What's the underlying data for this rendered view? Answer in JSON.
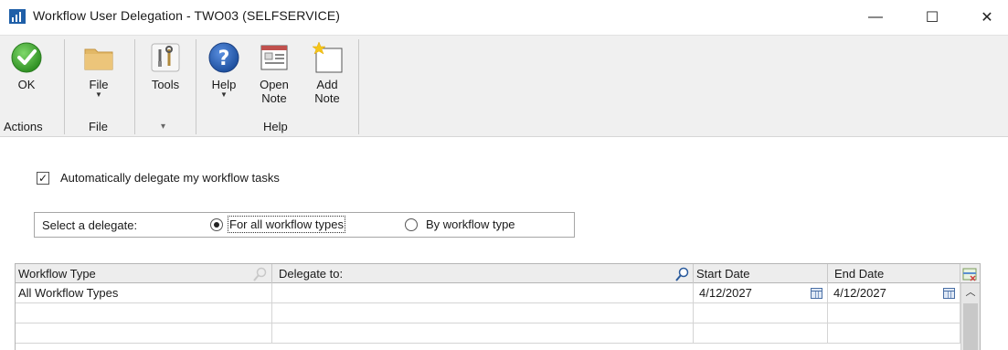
{
  "window": {
    "title": "Workflow User Delegation  -  TWO03 (SELFSERVICE)",
    "minimize": "—",
    "maximize": "☐",
    "close": "✕"
  },
  "ribbon": {
    "ok": {
      "label": "OK",
      "icon": "checkmark-circle-icon"
    },
    "file": {
      "label": "File",
      "icon": "folder-icon"
    },
    "tools": {
      "label": "Tools",
      "icon": "tools-icon"
    },
    "help": {
      "label": "Help",
      "icon": "question-icon"
    },
    "open_note": {
      "line1": "Open",
      "line2": "Note",
      "icon": "open-note-icon"
    },
    "add_note": {
      "line1": "Add",
      "line2": "Note",
      "icon": "add-note-icon"
    },
    "groups": {
      "actions": "Actions",
      "file": "File",
      "tools_caret": "▾",
      "help": "Help"
    }
  },
  "form": {
    "auto_delegate_label": "Automatically delegate my workflow tasks",
    "auto_delegate_checked": true,
    "select_delegate_label": "Select a delegate:",
    "option_all": "For all workflow types",
    "option_by_type": "By workflow type",
    "selected_option": "all"
  },
  "grid": {
    "columns": [
      "Workflow Type",
      "Delegate to:",
      "Start Date",
      "End Date"
    ],
    "rows": [
      {
        "workflow_type": "All Workflow Types",
        "delegate_to": "",
        "start_date": "4/12/2027",
        "end_date": "4/12/2027"
      }
    ],
    "colors": {
      "header_bg": "#ededed",
      "border": "#b5b5b5"
    }
  }
}
